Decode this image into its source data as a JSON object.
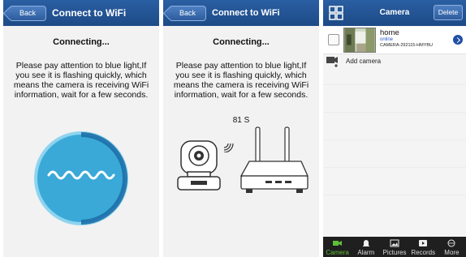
{
  "screen1": {
    "back_label": "Back",
    "title": "Connect to WiFi",
    "heading": "Connecting...",
    "message": "Please pay attention to blue light,If you see it is flashing quickly, which means the camera is receiving WiFi information, wait for a few seconds."
  },
  "screen2": {
    "back_label": "Back",
    "title": "Connect to WiFi",
    "heading": "Connecting...",
    "message": "Please pay attention to blue light,If you see it is flashing quickly, which means the camera is receiving WiFi information, wait for a few seconds.",
    "countdown": "81 S"
  },
  "screen3": {
    "title": "Camera",
    "delete_label": "Delete",
    "camera": {
      "name": "home",
      "status": "online",
      "id": "CAMERA-292115-HMYBU"
    },
    "add_label": "Add camera",
    "tabs": [
      {
        "label": "Camera",
        "icon": "camera-icon",
        "active": true
      },
      {
        "label": "Alarm",
        "icon": "bell-icon",
        "active": false
      },
      {
        "label": "Pictures",
        "icon": "picture-icon",
        "active": false
      },
      {
        "label": "Records",
        "icon": "record-icon",
        "active": false
      },
      {
        "label": "More",
        "icon": "more-icon",
        "active": false
      }
    ]
  },
  "colors": {
    "topbar": "#1d4a86",
    "accent_green": "#5fbf3a",
    "ring_blue": "#3aa9d8",
    "status_blue": "#2455c9"
  }
}
